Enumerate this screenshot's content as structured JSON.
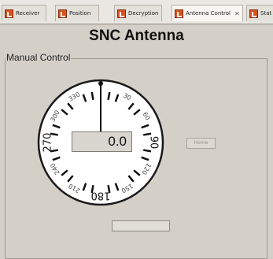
{
  "tabs": [
    {
      "label": "Receiver"
    },
    {
      "label": "Position"
    },
    {
      "label": "Decryption"
    },
    {
      "label": "Antenna Control",
      "close": "✕",
      "active": true
    },
    {
      "label": "Stat"
    }
  ],
  "title": "SNC Antenna",
  "group_label": "Manual Control",
  "dial": {
    "heading_value": "0.0",
    "needle_degrees": 0,
    "labels": [
      "0",
      "30",
      "60",
      "90",
      "120",
      "150",
      "180",
      "210",
      "240",
      "270",
      "300",
      "330"
    ]
  },
  "home_button": "Home",
  "entry_value": ""
}
